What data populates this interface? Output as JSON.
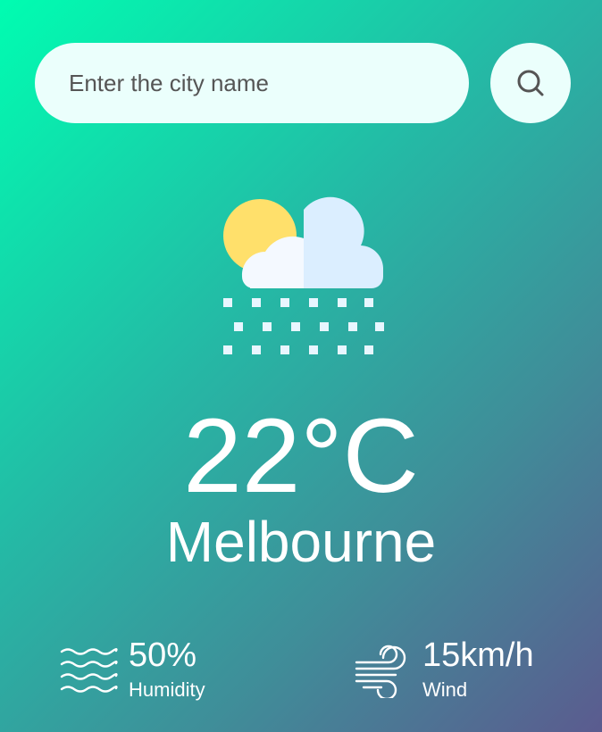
{
  "search": {
    "placeholder": "Enter the city name",
    "value": "",
    "button_icon": "search-icon"
  },
  "weather": {
    "icon": "sun-cloud-snow-icon",
    "temperature": "22°C",
    "city": "Melbourne"
  },
  "details": {
    "humidity": {
      "icon": "humidity-waves-icon",
      "value": "50%",
      "label": "Humidity"
    },
    "wind": {
      "icon": "wind-icon",
      "value": "15km/h",
      "label": "Wind"
    }
  },
  "colors": {
    "gradient_start": "#00fdb1",
    "gradient_end": "#5b5b8f",
    "input_bg": "#ebfffc",
    "text": "#ffffff"
  }
}
